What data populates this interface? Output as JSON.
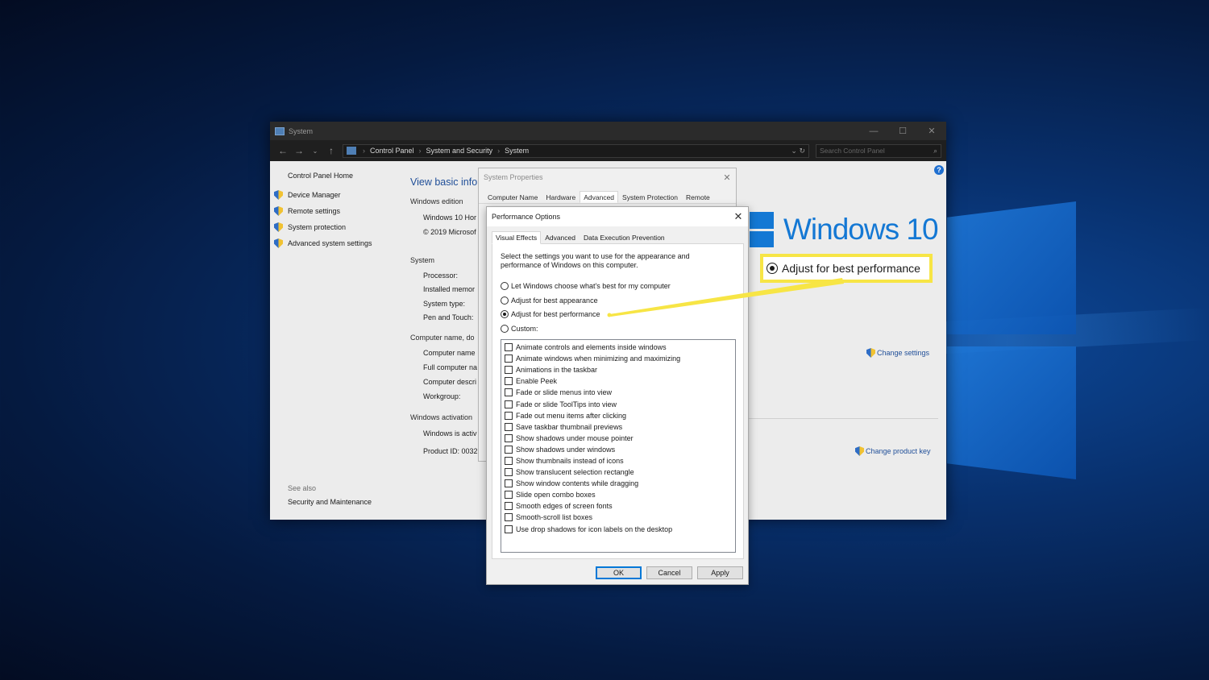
{
  "window": {
    "title": "System",
    "controls": {
      "minimize": "—",
      "maximize": "☐",
      "close": "✕"
    }
  },
  "addressbar": {
    "crumbs": [
      "Control Panel",
      "System and Security",
      "System"
    ],
    "search_placeholder": "Search Control Panel"
  },
  "sidebar": {
    "home": "Control Panel Home",
    "items": [
      "Device Manager",
      "Remote settings",
      "System protection",
      "Advanced system settings"
    ],
    "see_also_header": "See also",
    "see_also_link": "Security and Maintenance"
  },
  "main": {
    "title": "View basic infor",
    "windows_edition_header": "Windows edition",
    "edition": "Windows 10 Hor",
    "copyright": "© 2019 Microsof",
    "system_header": "System",
    "processor": "Processor:",
    "installed_memory": "Installed memor",
    "system_type": "System type:",
    "pen_touch": "Pen and Touch:",
    "computer_header": "Computer name, do",
    "computer_name": "Computer name",
    "full_name": "Full computer na",
    "computer_desc": "Computer descri",
    "workgroup": "Workgroup:",
    "activation_header": "Windows activation",
    "activation_status": "Windows is activ",
    "product_id": "Product ID:  0032",
    "logo_text": "Windows 10",
    "change_settings": "Change settings",
    "change_product_key": "Change product key",
    "help": "?"
  },
  "system_properties": {
    "title": "System Properties",
    "tabs": [
      "Computer Name",
      "Hardware",
      "Advanced",
      "System Protection",
      "Remote"
    ],
    "active_tab": "Advanced"
  },
  "performance_options": {
    "title": "Performance Options",
    "tabs": [
      "Visual Effects",
      "Advanced",
      "Data Execution Prevention"
    ],
    "active_tab": "Visual Effects",
    "description": "Select the settings you want to use for the appearance and performance of Windows on this computer.",
    "radios": [
      {
        "label": "Let Windows choose what's best for my computer",
        "selected": false
      },
      {
        "label": "Adjust for best appearance",
        "selected": false
      },
      {
        "label": "Adjust for best performance",
        "selected": true
      },
      {
        "label": "Custom:",
        "selected": false
      }
    ],
    "checkboxes": [
      "Animate controls and elements inside windows",
      "Animate windows when minimizing and maximizing",
      "Animations in the taskbar",
      "Enable Peek",
      "Fade or slide menus into view",
      "Fade or slide ToolTips into view",
      "Fade out menu items after clicking",
      "Save taskbar thumbnail previews",
      "Show shadows under mouse pointer",
      "Show shadows under windows",
      "Show thumbnails instead of icons",
      "Show translucent selection rectangle",
      "Show window contents while dragging",
      "Slide open combo boxes",
      "Smooth edges of screen fonts",
      "Smooth-scroll list boxes",
      "Use drop shadows for icon labels on the desktop"
    ],
    "buttons": {
      "ok": "OK",
      "cancel": "Cancel",
      "apply": "Apply"
    }
  },
  "callout": {
    "label": "Adjust for best performance",
    "color": "#f7e545"
  }
}
